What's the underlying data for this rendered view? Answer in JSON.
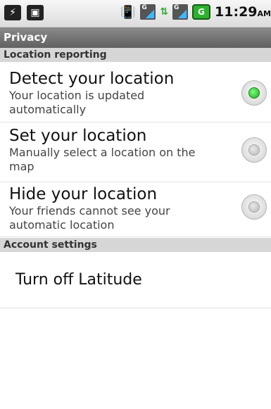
{
  "status_bar": {
    "left_icons": [
      "usb-icon",
      "android-debug-icon"
    ],
    "right_icons": [
      "vibrate-icon",
      "signal-icon",
      "data-arrows-icon",
      "signal-icon",
      "battery-icon"
    ],
    "signal_label": "G",
    "battery_glyph": "G",
    "time": "11:29",
    "ampm": "AM"
  },
  "title_bar": {
    "title": "Privacy"
  },
  "location_reporting": {
    "header": "Location reporting",
    "options": [
      {
        "title": "Detect your location",
        "summary": "Your location is updated automatically",
        "selected": true
      },
      {
        "title": "Set your location",
        "summary": "Manually select a location on the map",
        "selected": false
      },
      {
        "title": "Hide your location",
        "summary": "Your friends cannot see your automatic location",
        "selected": false
      }
    ]
  },
  "account_settings": {
    "header": "Account settings",
    "turn_off_label": "Turn off Latitude"
  },
  "colors": {
    "title_bar": "#6f6f6f",
    "section_header": "#d6d6d6",
    "radio_selected": "#2bbf2b"
  }
}
